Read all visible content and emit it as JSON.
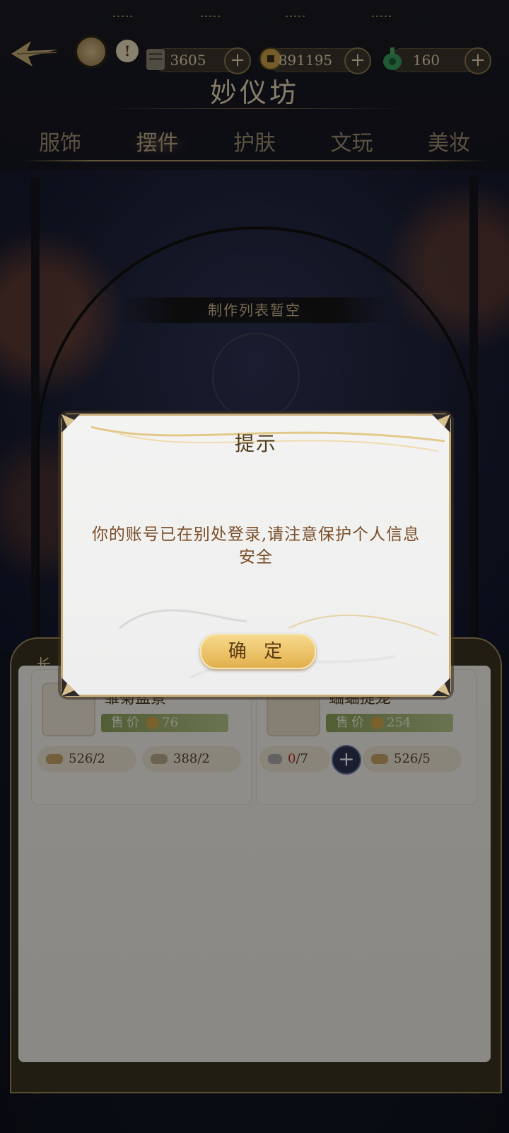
{
  "header": {
    "title": "妙仪坊",
    "resources": [
      {
        "value": "3605",
        "icon": "scroll-icon"
      },
      {
        "value": "891195",
        "icon": "coin-icon"
      },
      {
        "value": "160",
        "icon": "jade-icon"
      }
    ],
    "plus_label": "+",
    "warn_label": "!"
  },
  "tabs": [
    "服饰",
    "摆件",
    "护肤",
    "文玩",
    "美妆"
  ],
  "active_tab": "摆件",
  "scene": {
    "empty_text": "制作列表暂空"
  },
  "panel": {
    "label": "长",
    "items": [
      {
        "name": "雏菊盆景",
        "price_label": "售价",
        "price": "76",
        "mat1": "526/2",
        "mat2": "388/2"
      },
      {
        "name": "蛐蛐提笼",
        "price_label": "售价",
        "price": "254",
        "mat1_have": "0",
        "mat1_need": "/7",
        "mat2": "526/5"
      }
    ]
  },
  "dialog": {
    "title": "提示",
    "message": "你的账号已在别处登录,请注意保护个人信息安全",
    "confirm": "确 定"
  },
  "colors": {
    "accent_gold": "#e2b04d",
    "dialog_text": "#7a4f2a",
    "price_green": "#8ca25c"
  }
}
